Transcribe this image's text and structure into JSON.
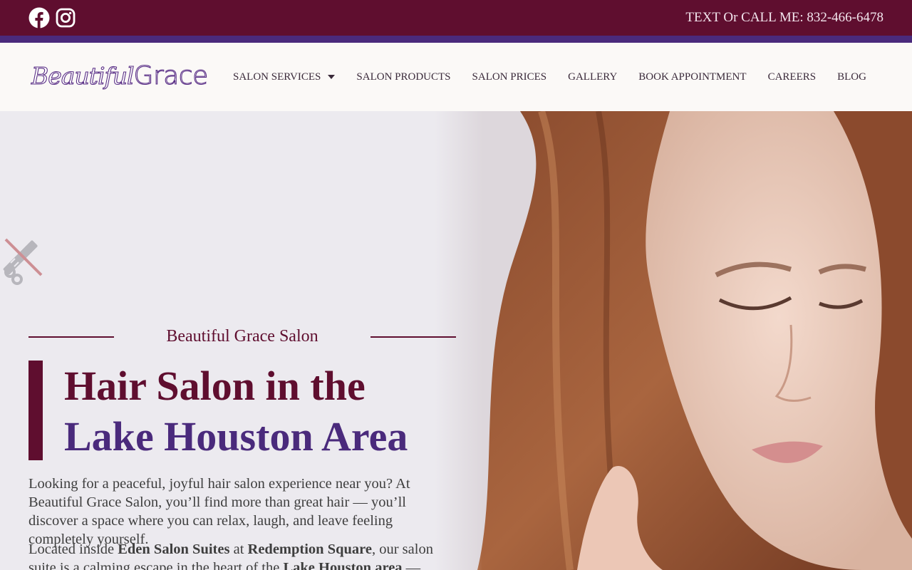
{
  "topbar": {
    "phone_text": "TEXT Or CALL ME: 832-466-6478",
    "social": [
      {
        "icon": "facebook-icon"
      },
      {
        "icon": "instagram-icon"
      }
    ],
    "colors": {
      "background": "#5f0e2f",
      "stripe": "#4a2a7c"
    }
  },
  "header": {
    "logo": {
      "script": "Beautiful",
      "sans": "Grace"
    },
    "nav": [
      {
        "label": "SALON SERVICES",
        "has_dropdown": true
      },
      {
        "label": "SALON PRODUCTS"
      },
      {
        "label": "SALON PRICES"
      },
      {
        "label": "GALLERY"
      },
      {
        "label": "BOOK APPOINTMENT"
      },
      {
        "label": "CAREERS"
      },
      {
        "label": "BLOG"
      }
    ]
  },
  "hero": {
    "eyebrow": "Beautiful Grace Salon",
    "headline_line1": "Hair Salon in the",
    "headline_line2": "Lake Houston Area",
    "intro": "Looking for a peaceful, joyful hair salon experience near you? At Beautiful Grace Salon, you’ll find more than great hair — you’ll discover a space where you can relax, laugh, and leave feeling completely yourself.",
    "para2": {
      "t1": "Located inside ",
      "b1": "Eden Salon Suites",
      "t2": " at ",
      "b2": "Redemption Square",
      "t3": ", our salon suite is a calming escape in the heart of the ",
      "b3": "Lake Houston area",
      "t4": " — trusted by"
    },
    "colors": {
      "burgundy": "#5f0e2f",
      "purple": "#4a2a7c"
    }
  }
}
